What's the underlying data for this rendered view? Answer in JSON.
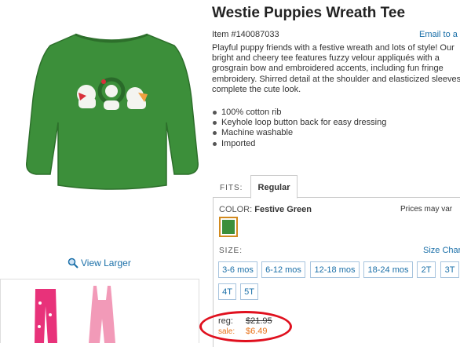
{
  "product": {
    "title": "Westie Puppies Wreath Tee",
    "item_number": "Item #140087033",
    "email_link": "Email to a f",
    "description": "Playful puppy friends with a festive wreath and lots of style! Our bright and cheery tee features fuzzy velour appliqués with a grosgrain bow and embroidered accents, including fun fringe embroidery. Shirred detail at the shoulder and elasticized sleeves complete the cute look.",
    "features": [
      "100% cotton rib",
      "Keyhole loop button back for easy dressing",
      "Machine washable",
      "Imported"
    ]
  },
  "gallery": {
    "view_larger": "View Larger"
  },
  "fits": {
    "label": "FITS:",
    "tab": "Regular"
  },
  "color": {
    "label": "COLOR:",
    "value": "Festive Green",
    "prices_vary": "Prices may var",
    "swatch_color": "#3c8f3a"
  },
  "size": {
    "label": "SIZE:",
    "chart_link": "Size Char",
    "options": [
      "3-6 mos",
      "6-12 mos",
      "12-18 mos",
      "18-24 mos",
      "2T",
      "3T",
      "4T",
      "5T"
    ]
  },
  "pricing": {
    "reg_label": "reg:",
    "reg_price": "$21.95",
    "sale_label": "sale:",
    "sale_price": "$6.49"
  },
  "colors": {
    "accent_link": "#1a6fa8",
    "sale": "#e8731a",
    "highlight": "#e0101e"
  }
}
